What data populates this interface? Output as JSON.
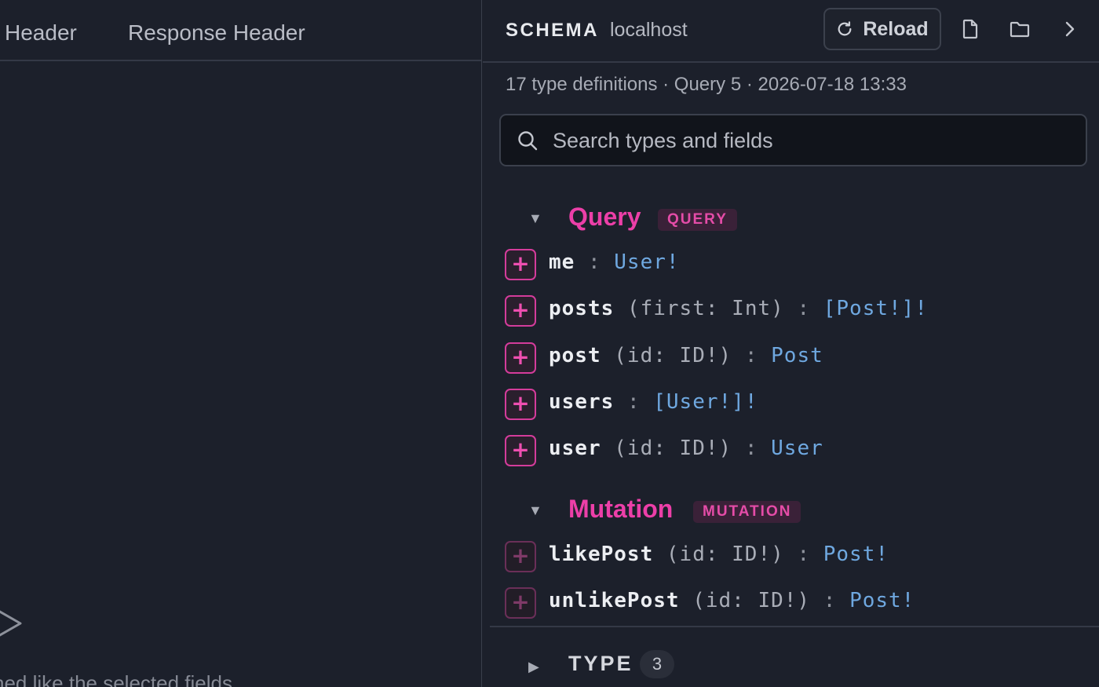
{
  "left_pane": {
    "tabs": [
      "Header",
      "Response Header"
    ],
    "hint": "ned like the selected fields"
  },
  "schema_panel": {
    "title": "SCHEMA",
    "host": "localhost",
    "reload_label": "Reload",
    "meta": "17 type definitions · Query 5 · 2026-07-18 13:33",
    "search": {
      "placeholder": "Search types and fields",
      "value": ""
    },
    "sections": [
      {
        "name": "Query",
        "badge": "QUERY",
        "fields": [
          {
            "name": "me",
            "args": "",
            "type": "User!"
          },
          {
            "name": "posts",
            "args": "(first: Int)",
            "type": "[Post!]!"
          },
          {
            "name": "post",
            "args": "(id: ID!)",
            "type": "Post"
          },
          {
            "name": "users",
            "args": "",
            "type": "[User!]!"
          },
          {
            "name": "user",
            "args": "(id: ID!)",
            "type": "User"
          }
        ]
      },
      {
        "name": "Mutation",
        "badge": "MUTATION",
        "fields": [
          {
            "name": "likePost",
            "args": "(id: ID!)",
            "type": "Post!"
          },
          {
            "name": "unlikePost",
            "args": "(id: ID!)",
            "type": "Post!"
          }
        ]
      }
    ],
    "type_group": {
      "label": "TYPE",
      "count": "3"
    },
    "add_glyph": "+",
    "separator": ":",
    "expanded_caret": "▼",
    "collapsed_caret": "▶"
  },
  "colors": {
    "accent_pink": "#ec3fa8",
    "type_blue": "#6fa8e0",
    "background": "#1c202b"
  },
  "icons": [
    "reload-icon",
    "file-icon",
    "folder-icon",
    "chevron-right-icon",
    "search-icon",
    "play-icon"
  ]
}
